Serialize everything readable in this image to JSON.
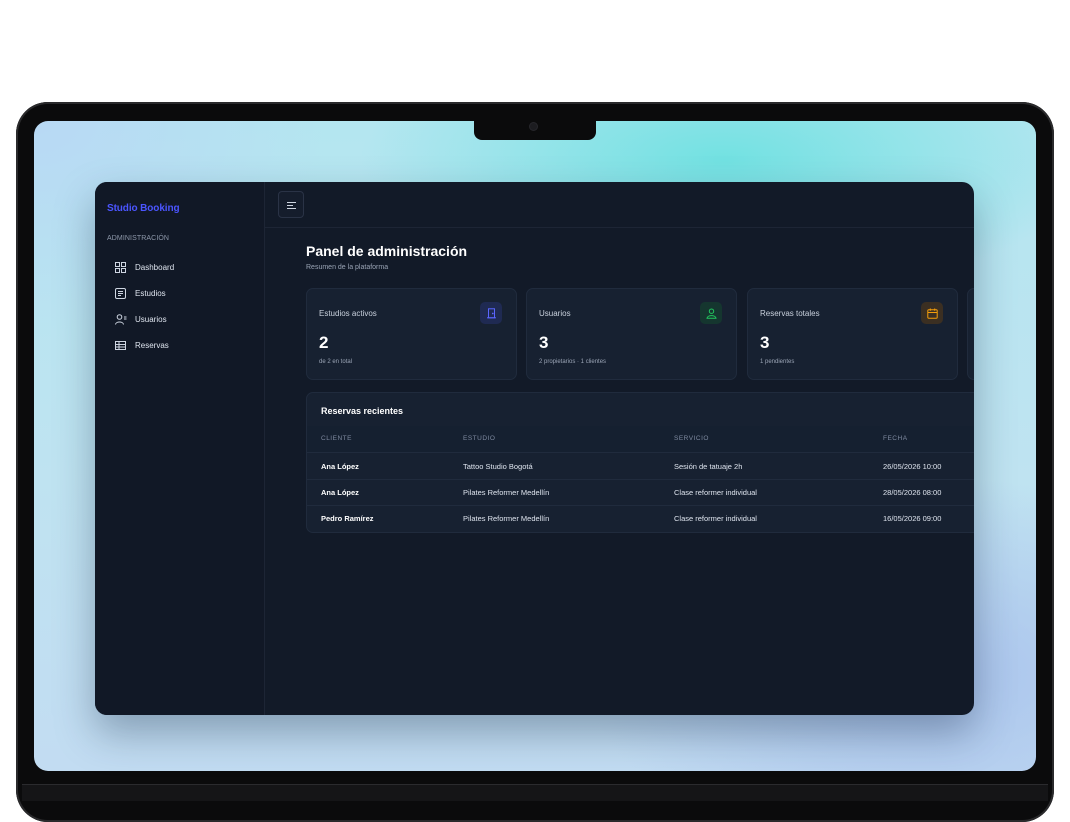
{
  "sidebar": {
    "brand": "Studio Booking",
    "section_label": "ADMINISTRACIÓN",
    "items": [
      {
        "label": "Dashboard",
        "icon": "grid-icon"
      },
      {
        "label": "Estudios",
        "icon": "list-box-icon"
      },
      {
        "label": "Usuarios",
        "icon": "users-icon"
      },
      {
        "label": "Reservas",
        "icon": "table-icon"
      }
    ]
  },
  "header": {
    "menu_icon": "menu-icon"
  },
  "main": {
    "title": "Panel de administración",
    "subtitle": "Resumen de la plataforma",
    "stats": [
      {
        "title": "Estudios activos",
        "value": "2",
        "meta": "de 2 en total",
        "icon": "door-icon",
        "color": "#4b55ff"
      },
      {
        "title": "Usuarios",
        "value": "3",
        "meta": "2 propietarios · 1 clientes",
        "icon": "user-icon",
        "color": "#22c55e"
      },
      {
        "title": "Reservas totales",
        "value": "3",
        "meta": "1 pendientes",
        "icon": "calendar-icon",
        "color": "#f59e0b"
      }
    ],
    "recent": {
      "title": "Reservas recientes",
      "columns": [
        "CLIENTE",
        "ESTUDIO",
        "SERVICIO",
        "FECHA"
      ],
      "rows": [
        [
          "Ana López",
          "Tattoo Studio Bogotá",
          "Sesión de tatuaje 2h",
          "26/05/2026 10:00"
        ],
        [
          "Ana López",
          "Pilates Reformer Medellín",
          "Clase reformer individual",
          "28/05/2026 08:00"
        ],
        [
          "Pedro Ramírez",
          "Pilates Reformer Medellín",
          "Clase reformer individual",
          "16/05/2026 09:00"
        ]
      ]
    }
  }
}
